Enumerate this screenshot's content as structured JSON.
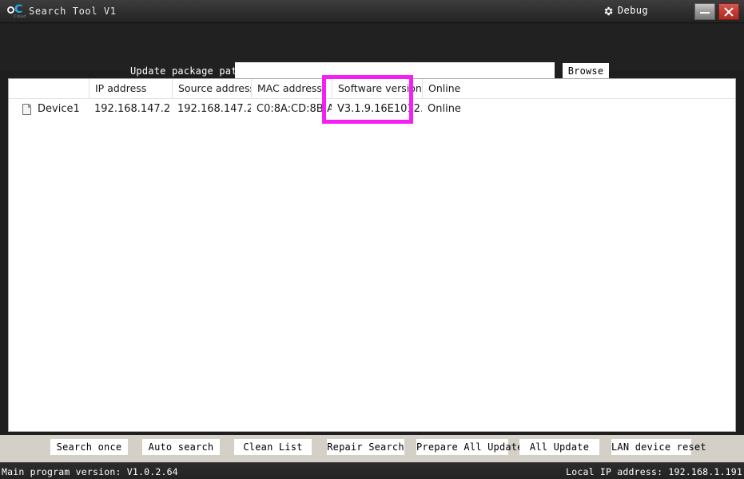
{
  "window": {
    "title": "Search Tool V1",
    "logo_icon": "oc-cloud-logo-icon",
    "logo_sub": "Cloud",
    "debug_label": "Debug",
    "debug_icon": "gear-icon",
    "minimize_icon": "minimize-icon",
    "close_icon": "close-icon",
    "close_color": "#c23a31"
  },
  "path_row": {
    "label": "Update package path:",
    "input_value": "",
    "input_placeholder": "",
    "browse_label": "Browse"
  },
  "table": {
    "columns": [
      {
        "key": "device",
        "label": ""
      },
      {
        "key": "ip",
        "label": "IP address"
      },
      {
        "key": "source",
        "label": "Source address"
      },
      {
        "key": "mac",
        "label": "MAC address"
      },
      {
        "key": "version",
        "label": "Software version"
      },
      {
        "key": "status",
        "label": "Online"
      }
    ],
    "rows": [
      {
        "icon": "device-document-icon",
        "device": "Device1",
        "ip": "192.168.147.2",
        "source": "192.168.147.2:...",
        "mac": "C0:8A:CD:8B:A..",
        "version": "V3.1.9.16E1012...",
        "status": "Online"
      }
    ]
  },
  "highlight": {
    "color": "#f41ff4",
    "target_column": "Software version"
  },
  "buttons": [
    {
      "name": "search-once",
      "label": "Search once"
    },
    {
      "name": "auto-search",
      "label": "Auto search"
    },
    {
      "name": "clean-list",
      "label": "Clean List"
    },
    {
      "name": "repair-search",
      "label": "Repair Search"
    },
    {
      "name": "prepare-all-update",
      "label": "Prepare All Update"
    },
    {
      "name": "all-update",
      "label": "All Update"
    },
    {
      "name": "lan-device-reset",
      "label": "LAN device reset"
    }
  ],
  "status_bar": {
    "left": "Main program version: V1.0.2.64",
    "right": "Local IP address: 192.168.1.191"
  }
}
